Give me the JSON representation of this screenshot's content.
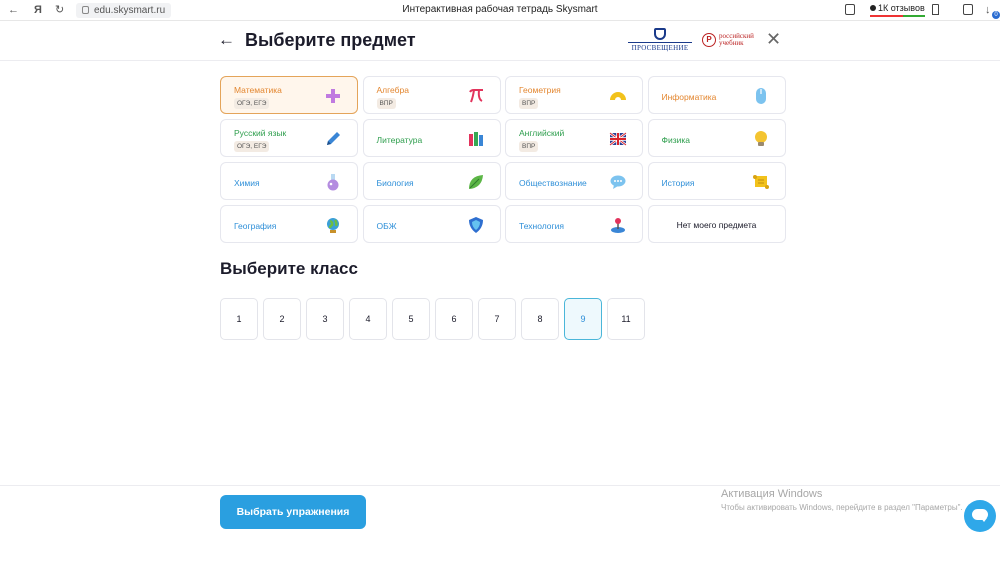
{
  "browser": {
    "yandex_glyph": "Я",
    "url": "edu.skysmart.ru",
    "tab_title": "Интерактивная рабочая тетрадь Skysmart",
    "reviews": "1К отзывов",
    "extension_badge": "0"
  },
  "header": {
    "title": "Выберите предмет",
    "logo_prosveshchenie": "ПРОСВЕЩЕНИЕ",
    "logo_rus_mark": "Р",
    "logo_rus_text": "российский учебник"
  },
  "subjects": [
    {
      "label": "Математика",
      "tag": "ОГЭ, ЕГЭ",
      "color": "#e3862f",
      "icon": "plus-icon",
      "selected": true
    },
    {
      "label": "Алгебра",
      "tag": "ВПР",
      "color": "#e3862f",
      "icon": "pi-icon"
    },
    {
      "label": "Геометрия",
      "tag": "ВПР",
      "color": "#e3862f",
      "icon": "protractor-icon"
    },
    {
      "label": "Информатика",
      "tag": "",
      "color": "#e3862f",
      "icon": "mouse-icon"
    },
    {
      "label": "Русский язык",
      "tag": "ОГЭ, ЕГЭ",
      "color": "#2e9e4d",
      "icon": "pen-icon"
    },
    {
      "label": "Литература",
      "tag": "",
      "color": "#2e9e4d",
      "icon": "books-icon"
    },
    {
      "label": "Английский",
      "tag": "ВПР",
      "color": "#2e9e4d",
      "icon": "uk-flag-icon"
    },
    {
      "label": "Физика",
      "tag": "",
      "color": "#2e9e4d",
      "icon": "lightbulb-icon"
    },
    {
      "label": "Химия",
      "tag": "",
      "color": "#2e8fd8",
      "icon": "flask-icon"
    },
    {
      "label": "Биология",
      "tag": "",
      "color": "#2e8fd8",
      "icon": "leaf-icon"
    },
    {
      "label": "Обществознание",
      "tag": "",
      "color": "#2e8fd8",
      "icon": "speech-bubble-icon"
    },
    {
      "label": "История",
      "tag": "",
      "color": "#2e8fd8",
      "icon": "scroll-icon"
    },
    {
      "label": "География",
      "tag": "",
      "color": "#2e8fd8",
      "icon": "globe-icon"
    },
    {
      "label": "ОБЖ",
      "tag": "",
      "color": "#2e8fd8",
      "icon": "shield-icon"
    },
    {
      "label": "Технология",
      "tag": "",
      "color": "#2e8fd8",
      "icon": "joystick-icon"
    },
    {
      "label": "Нет моего предмета",
      "tag": "",
      "color": "#1c1c2b",
      "icon": ""
    }
  ],
  "class_section": {
    "title": "Выберите класс",
    "grades": [
      "1",
      "2",
      "3",
      "4",
      "5",
      "6",
      "7",
      "8",
      "9",
      "11"
    ],
    "selected": "9"
  },
  "footer": {
    "cta_label": "Выбрать упражнения",
    "watermark_title": "Активация Windows",
    "watermark_sub": "Чтобы активировать Windows, перейдите в раздел \"Параметры\"."
  }
}
